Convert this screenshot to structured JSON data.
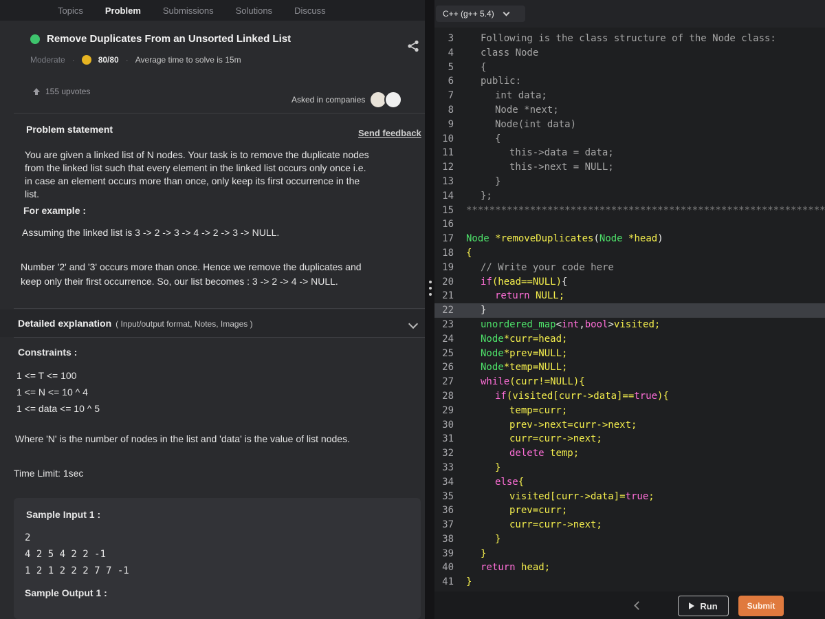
{
  "tabs": [
    "Topics",
    "Problem",
    "Submissions",
    "Solutions",
    "Discuss"
  ],
  "problem": {
    "title": "Remove Duplicates From an Unsorted Linked List",
    "difficulty": "Moderate",
    "score": "80/80",
    "avg_time": "Average time to solve is 15m",
    "upvotes": "155 upvotes",
    "asked_in": "Asked in companies",
    "statement_heading": "Problem statement",
    "send_feedback": "Send feedback",
    "statement": [
      "You are given a linked list of N nodes. Your task is to remove the duplicate nodes",
      "from the linked list such that every element in the linked list occurs only once i.e.",
      "in case an element occurs more than once, only keep its first occurrence in the",
      "list."
    ],
    "for_example": "For example :",
    "example_assumption": "Assuming the linked list is 3 -> 2 -> 3 -> 4 -> 2 -> 3 -> NULL.",
    "example_explain_1": "Number '2' and '3' occurs more than once. Hence we remove the duplicates and",
    "example_explain_2": "keep only their first occurrence. So, our list becomes : 3 -> 2 -> 4 -> NULL.",
    "detailed_label": "Detailed explanation",
    "detailed_sub": "( Input/output format, Notes, Images )",
    "constraints_label": "Constraints :",
    "constraints": [
      "1 <= T <= 100",
      "1 <= N <= 10 ^ 4",
      "1 <= data <= 10 ^ 5"
    ],
    "where_text": "Where 'N' is the number of nodes in the list and 'data' is the value of list nodes.",
    "time_limit": "Time Limit: 1sec",
    "sample_input_label": "Sample Input 1 :",
    "sample_input": [
      "2",
      "4 2 5 4 2 2 -1",
      "1 2 1 2 2 2 7 7 -1"
    ],
    "sample_output_label": "Sample Output 1 :"
  },
  "editor": {
    "language": "C++ (g++ 5.4)",
    "run_label": "Run",
    "submit_label": "Submit",
    "current_line": 22,
    "lines": [
      {
        "n": "3",
        "indent": 1,
        "parts": [
          [
            "c-com",
            "Following is the class structure of the Node class:"
          ]
        ]
      },
      {
        "n": "4",
        "indent": 1,
        "parts": [
          [
            "c-com",
            "class Node"
          ]
        ]
      },
      {
        "n": "5",
        "indent": 1,
        "parts": [
          [
            "c-com",
            "{"
          ]
        ]
      },
      {
        "n": "6",
        "indent": 1,
        "parts": [
          [
            "c-com",
            "public:"
          ]
        ]
      },
      {
        "n": "7",
        "indent": 2,
        "parts": [
          [
            "c-com",
            "int data;"
          ]
        ]
      },
      {
        "n": "8",
        "indent": 2,
        "parts": [
          [
            "c-com",
            "Node *next;"
          ]
        ]
      },
      {
        "n": "9",
        "indent": 2,
        "parts": [
          [
            "c-com",
            "Node(int data)"
          ]
        ]
      },
      {
        "n": "10",
        "indent": 2,
        "parts": [
          [
            "c-com",
            "{"
          ]
        ]
      },
      {
        "n": "11",
        "indent": 3,
        "parts": [
          [
            "c-com",
            "this->data = data;"
          ]
        ]
      },
      {
        "n": "12",
        "indent": 3,
        "parts": [
          [
            "c-com",
            "this->next = NULL;"
          ]
        ]
      },
      {
        "n": "13",
        "indent": 2,
        "parts": [
          [
            "c-com",
            "}"
          ]
        ]
      },
      {
        "n": "14",
        "indent": 1,
        "parts": [
          [
            "c-com",
            "};"
          ]
        ]
      },
      {
        "n": "15",
        "indent": 0,
        "parts": [
          [
            "c-ast",
            "*****************************************************************"
          ]
        ]
      },
      {
        "n": "16",
        "indent": 0,
        "parts": []
      },
      {
        "n": "17",
        "indent": 0,
        "parts": [
          [
            "c-ty",
            "Node "
          ],
          [
            "c-id",
            "*removeDuplicates"
          ],
          [
            "c-pl",
            "("
          ],
          [
            "c-ty",
            "Node "
          ],
          [
            "c-id",
            "*head"
          ],
          [
            "c-pl",
            ")"
          ]
        ]
      },
      {
        "n": "18",
        "indent": 0,
        "parts": [
          [
            "c-id",
            "{"
          ]
        ]
      },
      {
        "n": "19",
        "indent": 1,
        "parts": [
          [
            "c-com",
            "// Write your code here"
          ]
        ]
      },
      {
        "n": "20",
        "indent": 1,
        "parts": [
          [
            "c-kw",
            "if"
          ],
          [
            "c-id",
            "(head==NULL)"
          ],
          [
            "c-pl",
            "{"
          ]
        ]
      },
      {
        "n": "21",
        "indent": 2,
        "parts": [
          [
            "c-kw",
            "return "
          ],
          [
            "c-id",
            "NULL;"
          ]
        ]
      },
      {
        "n": "22",
        "indent": 1,
        "parts": [
          [
            "c-pl",
            "}"
          ]
        ]
      },
      {
        "n": "23",
        "indent": 1,
        "parts": [
          [
            "c-ty",
            "unordered_map"
          ],
          [
            "c-pl",
            "<"
          ],
          [
            "c-kw",
            "int"
          ],
          [
            "c-pl",
            ","
          ],
          [
            "c-kw",
            "bool"
          ],
          [
            "c-pl",
            ">"
          ],
          [
            "c-id",
            "visited;"
          ]
        ]
      },
      {
        "n": "24",
        "indent": 1,
        "parts": [
          [
            "c-ty",
            "Node"
          ],
          [
            "c-id",
            "*curr=head;"
          ]
        ]
      },
      {
        "n": "25",
        "indent": 1,
        "parts": [
          [
            "c-ty",
            "Node"
          ],
          [
            "c-id",
            "*prev=NULL;"
          ]
        ]
      },
      {
        "n": "26",
        "indent": 1,
        "parts": [
          [
            "c-ty",
            "Node"
          ],
          [
            "c-id",
            "*temp=NULL;"
          ]
        ]
      },
      {
        "n": "27",
        "indent": 1,
        "parts": [
          [
            "c-kw",
            "while"
          ],
          [
            "c-id",
            "(curr!=NULL){"
          ]
        ]
      },
      {
        "n": "28",
        "indent": 2,
        "parts": [
          [
            "c-kw",
            "if"
          ],
          [
            "c-id",
            "(visited[curr->data]=="
          ],
          [
            "c-kw",
            "true"
          ],
          [
            "c-id",
            "){"
          ]
        ]
      },
      {
        "n": "29",
        "indent": 3,
        "parts": [
          [
            "c-id",
            "temp=curr;"
          ]
        ]
      },
      {
        "n": "30",
        "indent": 3,
        "parts": [
          [
            "c-id",
            "prev->next=curr->next;"
          ]
        ]
      },
      {
        "n": "31",
        "indent": 3,
        "parts": [
          [
            "c-id",
            "curr=curr->next;"
          ]
        ]
      },
      {
        "n": "32",
        "indent": 3,
        "parts": [
          [
            "c-kw",
            "delete "
          ],
          [
            "c-id",
            "temp;"
          ]
        ]
      },
      {
        "n": "33",
        "indent": 2,
        "parts": [
          [
            "c-id",
            "}"
          ]
        ]
      },
      {
        "n": "34",
        "indent": 2,
        "parts": [
          [
            "c-kw",
            "else"
          ],
          [
            "c-id",
            "{"
          ]
        ]
      },
      {
        "n": "35",
        "indent": 3,
        "parts": [
          [
            "c-id",
            "visited[curr->data]="
          ],
          [
            "c-kw",
            "true"
          ],
          [
            "c-id",
            ";"
          ]
        ]
      },
      {
        "n": "36",
        "indent": 3,
        "parts": [
          [
            "c-id",
            "prev=curr;"
          ]
        ]
      },
      {
        "n": "37",
        "indent": 3,
        "parts": [
          [
            "c-id",
            "curr=curr->next;"
          ]
        ]
      },
      {
        "n": "38",
        "indent": 2,
        "parts": [
          [
            "c-id",
            "}"
          ]
        ]
      },
      {
        "n": "39",
        "indent": 1,
        "parts": [
          [
            "c-id",
            "}"
          ]
        ]
      },
      {
        "n": "40",
        "indent": 1,
        "parts": [
          [
            "c-kw",
            "return "
          ],
          [
            "c-id",
            "head;"
          ]
        ]
      },
      {
        "n": "41",
        "indent": 0,
        "parts": [
          [
            "c-id",
            "}"
          ]
        ]
      }
    ]
  },
  "colors": {
    "accent_green": "#3ec46d",
    "submit_orange": "#e07a3e",
    "keyword_pink": "#ff6fd8",
    "type_green": "#4ee36a",
    "ident_yellow": "#f6f04d"
  }
}
